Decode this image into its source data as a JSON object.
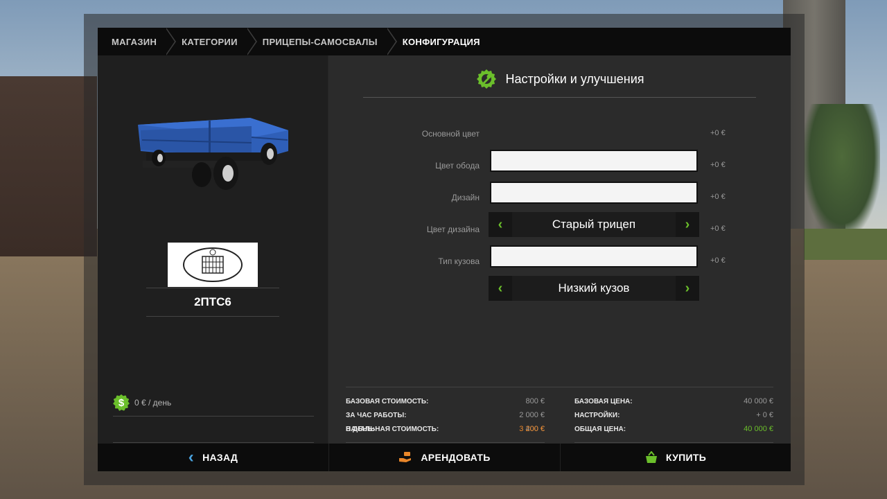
{
  "breadcrumb": {
    "items": [
      {
        "label": "МАГАЗИН"
      },
      {
        "label": "КАТЕГОРИИ"
      },
      {
        "label": "ПРИЦЕПЫ-САМОСВАЛЫ"
      },
      {
        "label": "КОНФИГУРАЦИЯ"
      }
    ]
  },
  "vehicle": {
    "model": "2ПТС6",
    "body_color": "#2f5fb8",
    "daily_cost": "0 € / день"
  },
  "settings": {
    "title": "Настройки и улучшения",
    "rows": [
      {
        "label": "Основной цвет",
        "type": "color",
        "price": "+0 €"
      },
      {
        "label": "Цвет обода",
        "type": "color",
        "price": "+0 €"
      },
      {
        "label": "Дизайн",
        "type": "select",
        "value": "Старый трицеп",
        "price": "+0 €"
      },
      {
        "label": "Цвет дизайна",
        "type": "color",
        "price": "+0 €"
      },
      {
        "label": "Тип кузова",
        "type": "select",
        "value": "Низкий кузов",
        "price": "+0 €"
      }
    ]
  },
  "summary": {
    "base_cost_label": "БАЗОВАЯ СТОИМОСТЬ:",
    "base_cost_value": "800 €",
    "per_hour_label": "ЗА ЧАС РАБОТЫ:",
    "per_hour_value": "2 000 €",
    "per_day_label": "В ДЕНЬ:",
    "per_day_value": "400 €",
    "initial_cost_label": "НАЧАЛЬНАЯ СТОИМОСТЬ:",
    "initial_cost_value": "3 200 €",
    "base_price_label": "БАЗОВАЯ ЦЕНА:",
    "base_price_value": "40 000 €",
    "settings_label": "НАСТРОЙКИ:",
    "settings_value": "+ 0 €",
    "total_label": "ОБЩАЯ ЦЕНА:",
    "total_value": "40 000 €"
  },
  "footer": {
    "back_label": "НАЗАД",
    "lease_label": "АРЕНДОВАТЬ",
    "buy_label": "КУПИТЬ"
  },
  "colors": {
    "accent_green": "#6bbf2b",
    "accent_orange": "#e8862a",
    "accent_blue": "#4aa3df"
  }
}
